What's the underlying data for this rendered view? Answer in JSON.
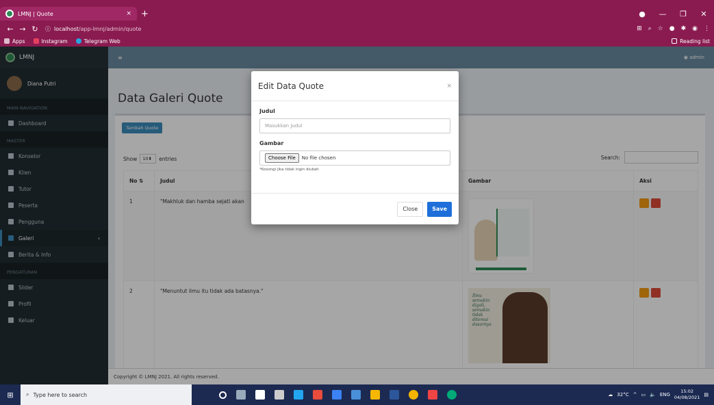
{
  "browser": {
    "tab_title": "LMNJ | Quote",
    "tab_close": "×",
    "new_tab": "+",
    "url_host": "localhost",
    "url_path": "/app-lmnj/admin/quote",
    "bookmarks": [
      "Apps",
      "Instagram",
      "Telegram Web"
    ],
    "reading_list": "Reading list"
  },
  "sidebar": {
    "logo": "LMNJ",
    "user": "Diana Putri",
    "sections": [
      {
        "header": "MAIN NAVIGATION",
        "items": [
          "Dashboard"
        ]
      },
      {
        "header": "MASTER",
        "items": [
          "Konselor",
          "Klien",
          "Tutor",
          "Peserta",
          "Pengguna",
          "Galeri",
          "Berita & Info"
        ]
      },
      {
        "header": "PENGATURAN",
        "items": [
          "Slider",
          "Profil",
          "Keluar"
        ]
      }
    ],
    "active": "Galeri"
  },
  "topnav": {
    "menu_glyph": "≡",
    "admin": "admin"
  },
  "page": {
    "title": "Data Galeri Quote",
    "add_button": "Tambah Quote",
    "show_label": "Show",
    "entries_value": "10",
    "entries_label": "entries",
    "search_label": "Search:",
    "columns": [
      "No",
      "Judul",
      "Gambar",
      "Aksi"
    ],
    "rows": [
      {
        "no": "1",
        "judul": "\"Makhluk dan hamba sejati akan"
      },
      {
        "no": "2",
        "judul": "\"Menuntut ilmu itu tidak ada batasnya.\""
      }
    ],
    "image_text": "Ilmu\nsemakin\ndigali,\nsemakin\ntidak\nditemui\ndasarnya"
  },
  "footer": {
    "text": "Copyright © LMNJ 2021. All rights reserved."
  },
  "modal": {
    "title": "Edit Data Quote",
    "close_x": "×",
    "judul_label": "Judul",
    "judul_placeholder": "Masukkan Judul",
    "gambar_label": "Gambar",
    "choose_file": "Choose File",
    "no_file": "No file chosen",
    "hint": "*Kosongi jika tidak ingin diubah",
    "close_button": "Close",
    "save_button": "Save"
  },
  "taskbar": {
    "search_placeholder": "Type here to search",
    "weather": "32°C",
    "lang": "ENG",
    "time": "15:02",
    "date": "04/08/2021"
  },
  "colors": {
    "accent": "#3c8dbc",
    "chrome": "#8a1b50",
    "sidebar": "#222d32"
  }
}
